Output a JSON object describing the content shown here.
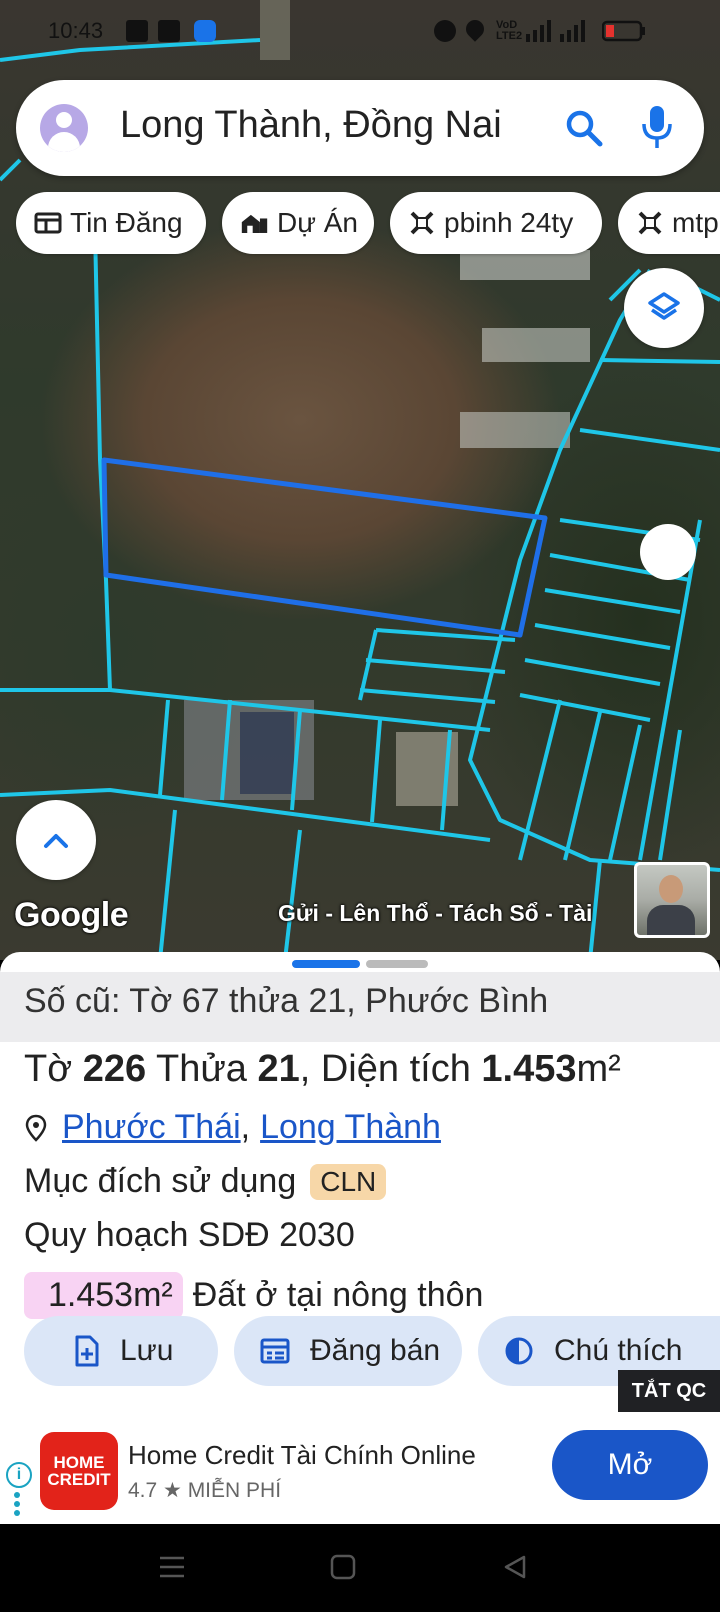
{
  "status_bar": {
    "time": "10:43",
    "battery_color": "#e5322e"
  },
  "search": {
    "query": "Long Thành, Đồng Nai"
  },
  "chips": [
    {
      "label": "Tin Đăng",
      "icon": "newspaper-icon"
    },
    {
      "label": "Dự Án",
      "icon": "buildings-icon"
    },
    {
      "label": "pbinh 24ty",
      "icon": "ruler-icon"
    },
    {
      "label": "mtp",
      "icon": "ruler-icon"
    }
  ],
  "map": {
    "logo": "Google",
    "caption": "Gửi - Lên Thổ - Tách Sổ - Tài",
    "parcel_line_color": "#1fc6e8",
    "selected_parcel_color": "#1f6fe8"
  },
  "parcel": {
    "old_number": "Số cũ: Tờ 67 thửa 21, Phước Bình",
    "sheet_label": "Tờ",
    "sheet_number": "226",
    "lot_label": "Thửa",
    "lot_number": "21",
    "area_label": ", Diện tích",
    "area_value": "1.453",
    "area_unit": "m²",
    "ward": "Phước Thái",
    "separator": ",",
    "district": "Long Thành",
    "purpose_label": "Mục đích sử dụng",
    "purpose_code": "CLN",
    "plan_label": "Quy hoạch SDĐ 2030",
    "plan_area": "1.453m²",
    "plan_type": "Đất ở tại nông thôn"
  },
  "actions": {
    "save": "Lưu",
    "sell": "Đăng bán",
    "legend": "Chú thích"
  },
  "ad": {
    "hide_label": "TẮT QC",
    "logo_line1": "HOME",
    "logo_line2": "CREDIT",
    "title": "Home Credit Tài Chính Online",
    "rating": "4.7 ★ MIỄN PHÍ",
    "open": "Mở",
    "accent": "#1a56c8"
  }
}
